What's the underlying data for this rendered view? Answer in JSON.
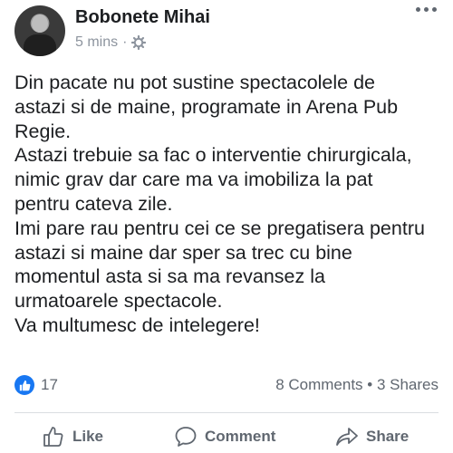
{
  "post": {
    "author": "Bobonete Mihai",
    "time": "5 mins",
    "separator": "·",
    "audience_icon": "gear-icon",
    "lines": [
      "Din pacate nu pot sustine spectacolele de",
      "astazi si de maine, programate in Arena Pub",
      "Regie.",
      "Astazi trebuie sa fac o interventie chirurgicala,",
      "nimic grav dar care ma va imobiliza la pat",
      "pentru cateva zile.",
      "Imi pare rau pentru cei ce se pregatisera pentru",
      "astazi si maine dar sper sa trec cu bine",
      "momentul asta si sa ma revansez la",
      "urmatoarele spectacole.",
      "Va multumesc de intelegere!"
    ]
  },
  "stats": {
    "likes": "17",
    "comments_shares": "8 Comments • 3 Shares"
  },
  "actions": {
    "like": "Like",
    "comment": "Comment",
    "share": "Share"
  },
  "colors": {
    "accent": "#1877f2",
    "muted": "#606770"
  }
}
